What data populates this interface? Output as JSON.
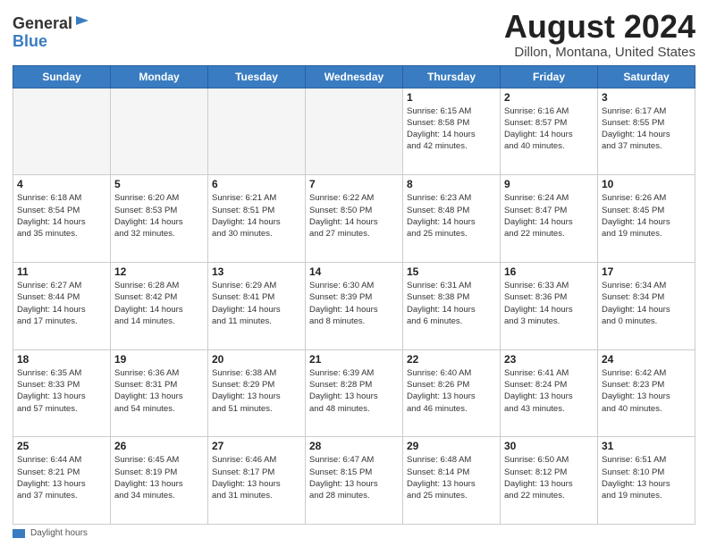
{
  "header": {
    "logo_general": "General",
    "logo_blue": "Blue",
    "title": "August 2024",
    "location": "Dillon, Montana, United States"
  },
  "days_of_week": [
    "Sunday",
    "Monday",
    "Tuesday",
    "Wednesday",
    "Thursday",
    "Friday",
    "Saturday"
  ],
  "weeks": [
    [
      {
        "day": "",
        "info": ""
      },
      {
        "day": "",
        "info": ""
      },
      {
        "day": "",
        "info": ""
      },
      {
        "day": "",
        "info": ""
      },
      {
        "day": "1",
        "info": "Sunrise: 6:15 AM\nSunset: 8:58 PM\nDaylight: 14 hours\nand 42 minutes."
      },
      {
        "day": "2",
        "info": "Sunrise: 6:16 AM\nSunset: 8:57 PM\nDaylight: 14 hours\nand 40 minutes."
      },
      {
        "day": "3",
        "info": "Sunrise: 6:17 AM\nSunset: 8:55 PM\nDaylight: 14 hours\nand 37 minutes."
      }
    ],
    [
      {
        "day": "4",
        "info": "Sunrise: 6:18 AM\nSunset: 8:54 PM\nDaylight: 14 hours\nand 35 minutes."
      },
      {
        "day": "5",
        "info": "Sunrise: 6:20 AM\nSunset: 8:53 PM\nDaylight: 14 hours\nand 32 minutes."
      },
      {
        "day": "6",
        "info": "Sunrise: 6:21 AM\nSunset: 8:51 PM\nDaylight: 14 hours\nand 30 minutes."
      },
      {
        "day": "7",
        "info": "Sunrise: 6:22 AM\nSunset: 8:50 PM\nDaylight: 14 hours\nand 27 minutes."
      },
      {
        "day": "8",
        "info": "Sunrise: 6:23 AM\nSunset: 8:48 PM\nDaylight: 14 hours\nand 25 minutes."
      },
      {
        "day": "9",
        "info": "Sunrise: 6:24 AM\nSunset: 8:47 PM\nDaylight: 14 hours\nand 22 minutes."
      },
      {
        "day": "10",
        "info": "Sunrise: 6:26 AM\nSunset: 8:45 PM\nDaylight: 14 hours\nand 19 minutes."
      }
    ],
    [
      {
        "day": "11",
        "info": "Sunrise: 6:27 AM\nSunset: 8:44 PM\nDaylight: 14 hours\nand 17 minutes."
      },
      {
        "day": "12",
        "info": "Sunrise: 6:28 AM\nSunset: 8:42 PM\nDaylight: 14 hours\nand 14 minutes."
      },
      {
        "day": "13",
        "info": "Sunrise: 6:29 AM\nSunset: 8:41 PM\nDaylight: 14 hours\nand 11 minutes."
      },
      {
        "day": "14",
        "info": "Sunrise: 6:30 AM\nSunset: 8:39 PM\nDaylight: 14 hours\nand 8 minutes."
      },
      {
        "day": "15",
        "info": "Sunrise: 6:31 AM\nSunset: 8:38 PM\nDaylight: 14 hours\nand 6 minutes."
      },
      {
        "day": "16",
        "info": "Sunrise: 6:33 AM\nSunset: 8:36 PM\nDaylight: 14 hours\nand 3 minutes."
      },
      {
        "day": "17",
        "info": "Sunrise: 6:34 AM\nSunset: 8:34 PM\nDaylight: 14 hours\nand 0 minutes."
      }
    ],
    [
      {
        "day": "18",
        "info": "Sunrise: 6:35 AM\nSunset: 8:33 PM\nDaylight: 13 hours\nand 57 minutes."
      },
      {
        "day": "19",
        "info": "Sunrise: 6:36 AM\nSunset: 8:31 PM\nDaylight: 13 hours\nand 54 minutes."
      },
      {
        "day": "20",
        "info": "Sunrise: 6:38 AM\nSunset: 8:29 PM\nDaylight: 13 hours\nand 51 minutes."
      },
      {
        "day": "21",
        "info": "Sunrise: 6:39 AM\nSunset: 8:28 PM\nDaylight: 13 hours\nand 48 minutes."
      },
      {
        "day": "22",
        "info": "Sunrise: 6:40 AM\nSunset: 8:26 PM\nDaylight: 13 hours\nand 46 minutes."
      },
      {
        "day": "23",
        "info": "Sunrise: 6:41 AM\nSunset: 8:24 PM\nDaylight: 13 hours\nand 43 minutes."
      },
      {
        "day": "24",
        "info": "Sunrise: 6:42 AM\nSunset: 8:23 PM\nDaylight: 13 hours\nand 40 minutes."
      }
    ],
    [
      {
        "day": "25",
        "info": "Sunrise: 6:44 AM\nSunset: 8:21 PM\nDaylight: 13 hours\nand 37 minutes."
      },
      {
        "day": "26",
        "info": "Sunrise: 6:45 AM\nSunset: 8:19 PM\nDaylight: 13 hours\nand 34 minutes."
      },
      {
        "day": "27",
        "info": "Sunrise: 6:46 AM\nSunset: 8:17 PM\nDaylight: 13 hours\nand 31 minutes."
      },
      {
        "day": "28",
        "info": "Sunrise: 6:47 AM\nSunset: 8:15 PM\nDaylight: 13 hours\nand 28 minutes."
      },
      {
        "day": "29",
        "info": "Sunrise: 6:48 AM\nSunset: 8:14 PM\nDaylight: 13 hours\nand 25 minutes."
      },
      {
        "day": "30",
        "info": "Sunrise: 6:50 AM\nSunset: 8:12 PM\nDaylight: 13 hours\nand 22 minutes."
      },
      {
        "day": "31",
        "info": "Sunrise: 6:51 AM\nSunset: 8:10 PM\nDaylight: 13 hours\nand 19 minutes."
      }
    ]
  ],
  "footer": {
    "label": "Daylight hours"
  }
}
